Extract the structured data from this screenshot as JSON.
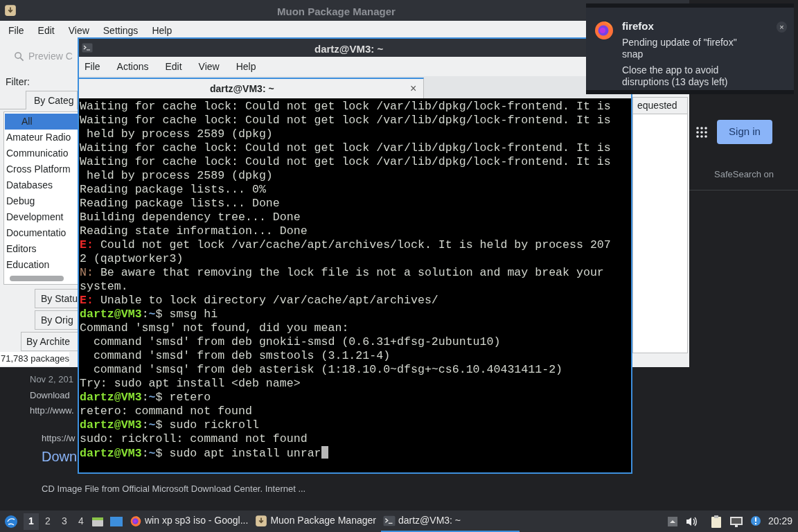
{
  "browser": {
    "results": [
      {
        "kind": "date",
        "text": "Nov 2, 201"
      },
      {
        "kind": "snippet",
        "text": "Download"
      },
      {
        "kind": "url",
        "text": "http://www."
      },
      {
        "kind": "url2",
        "text": "https://w"
      },
      {
        "kind": "link",
        "text": "Down"
      },
      {
        "kind": "snippet2",
        "text": "CD Image File from Official Microsoft Download Center. Internet ..."
      }
    ],
    "sign_in": "Sign in",
    "safesearch": "SafeSearch on"
  },
  "muon": {
    "title": "Muon Package Manager",
    "menu": [
      "File",
      "Edit",
      "View",
      "Settings",
      "Help"
    ],
    "search_placeholder": "Preview C",
    "filter_label": "Filter:",
    "category_tab": "By Categ",
    "categories": [
      {
        "label": "All",
        "selected": true
      },
      {
        "label": "Amateur Radio",
        "selected": false
      },
      {
        "label": "Communicatio",
        "selected": false
      },
      {
        "label": "Cross Platform",
        "selected": false
      },
      {
        "label": "Databases",
        "selected": false
      },
      {
        "label": "Debug",
        "selected": false
      },
      {
        "label": "Development",
        "selected": false
      },
      {
        "label": "Documentatio",
        "selected": false
      },
      {
        "label": "Editors",
        "selected": false
      },
      {
        "label": "Education",
        "selected": false
      }
    ],
    "filter_buttons": [
      {
        "label": "By Statu",
        "kind": "inner"
      },
      {
        "label": "By Orig",
        "kind": "inner"
      },
      {
        "label": "By Archite",
        "kind": "outer"
      }
    ],
    "status": "71,783 packages",
    "column_header": "equested"
  },
  "terminal": {
    "title": "dartz@VM3: ~",
    "menu": [
      "File",
      "Actions",
      "Edit",
      "View",
      "Help"
    ],
    "tab": "dartz@VM3: ~",
    "tab_close": "×",
    "cursor_visible": true,
    "lines": [
      {
        "kind": "text",
        "text": "Waiting for cache lock: Could not get lock /var/lib/dpkg/lock-frontend. It is"
      },
      {
        "kind": "text",
        "text": "Waiting for cache lock: Could not get lock /var/lib/dpkg/lock-frontend. It is"
      },
      {
        "kind": "text",
        "text": " held by process 2589 (dpkg)"
      },
      {
        "kind": "text",
        "text": "Waiting for cache lock: Could not get lock /var/lib/dpkg/lock-frontend. It is"
      },
      {
        "kind": "text",
        "text": "Waiting for cache lock: Could not get lock /var/lib/dpkg/lock-frontend. It is"
      },
      {
        "kind": "text",
        "text": " held by process 2589 (dpkg)"
      },
      {
        "kind": "text",
        "text": "Reading package lists... 0%"
      },
      {
        "kind": "text",
        "text": "Reading package lists... Done"
      },
      {
        "kind": "text",
        "text": "Building dependency tree... Done"
      },
      {
        "kind": "text",
        "text": "Reading state information... Done"
      },
      {
        "kind": "error",
        "prefix": "E:",
        "text": " Could not get lock /var/cache/apt/archives/lock. It is held by process 207"
      },
      {
        "kind": "text",
        "text": "2 (qaptworker3)"
      },
      {
        "kind": "note",
        "prefix": "N:",
        "text": " Be aware that removing the lock file is not a solution and may break your"
      },
      {
        "kind": "text",
        "text": "system."
      },
      {
        "kind": "error",
        "prefix": "E:",
        "text": " Unable to lock directory /var/cache/apt/archives/"
      },
      {
        "kind": "prompt",
        "user": "dartz@VM3",
        "path": "~",
        "symbol": "$",
        "command": " smsg hi",
        "separator": ":"
      },
      {
        "kind": "text",
        "text": "Command 'smsg' not found, did you mean:"
      },
      {
        "kind": "text",
        "text": "  command 'smsd' from deb gnokii-smsd (0.6.31+dfsg-2ubuntu10)"
      },
      {
        "kind": "text",
        "text": "  command 'smsd' from deb smstools (3.1.21-4)"
      },
      {
        "kind": "text",
        "text": "  command 'smsq' from deb asterisk (1:18.10.0~dfsg+~cs6.10.40431411-2)"
      },
      {
        "kind": "text",
        "text": "Try: sudo apt install <deb name>"
      },
      {
        "kind": "prompt",
        "user": "dartz@VM3",
        "path": "~",
        "symbol": "$",
        "command": " retero",
        "separator": ":"
      },
      {
        "kind": "text",
        "text": "retero: command not found"
      },
      {
        "kind": "prompt",
        "user": "dartz@VM3",
        "path": "~",
        "symbol": "$",
        "command": " sudo rickroll",
        "separator": ":"
      },
      {
        "kind": "text",
        "text": "sudo: rickroll: command not found"
      },
      {
        "kind": "prompt",
        "user": "dartz@VM3",
        "path": "~",
        "symbol": "$",
        "command": " sudo apt install unrar",
        "separator": ":"
      }
    ]
  },
  "notification": {
    "app": "firefox",
    "message": "Pending update of \"firefox\" snap",
    "detail": "Close the app to avoid disruptions (13 days left)",
    "close": "×"
  },
  "taskbar": {
    "workspaces": [
      {
        "label": "1",
        "selected": true
      },
      {
        "label": "2",
        "selected": false
      },
      {
        "label": "3",
        "selected": false
      },
      {
        "label": "4",
        "selected": false
      }
    ],
    "tasks": [
      {
        "kind": "firefox",
        "label": "win xp sp3 iso - Googl...",
        "selected": false
      },
      {
        "kind": "muon",
        "label": "Muon Package Manager",
        "selected": false
      },
      {
        "kind": "terminal",
        "label": "dartz@VM3: ~",
        "selected": true
      }
    ],
    "clock": "20:29"
  }
}
